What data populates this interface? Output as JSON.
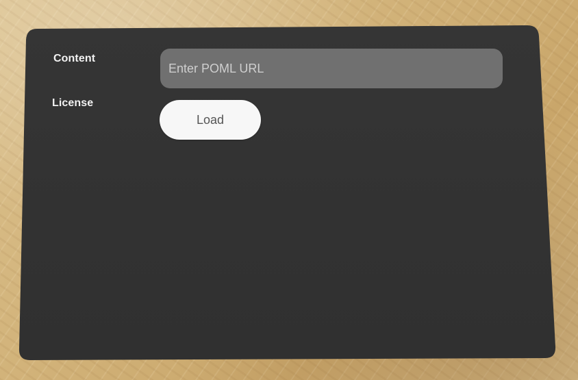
{
  "form": {
    "content_label": "Content",
    "license_label": "License",
    "url_placeholder": "Enter POML URL",
    "load_label": "Load"
  },
  "colors": {
    "panel": "#333333",
    "input_background": "#707070",
    "button_background": "#f7f7f7",
    "label_text": "#f2f2f2"
  }
}
